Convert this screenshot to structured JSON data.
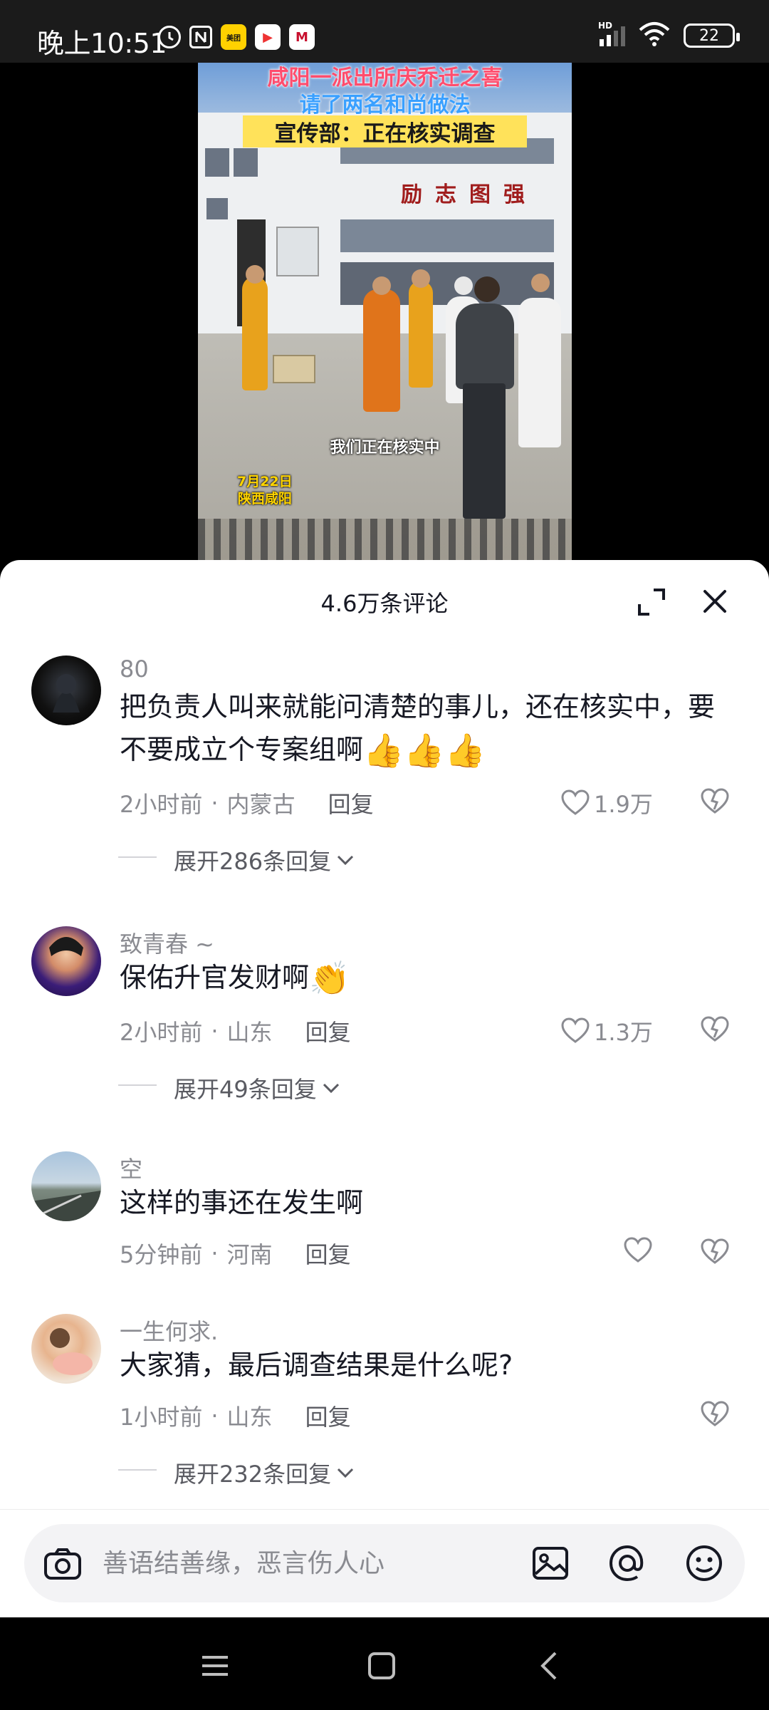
{
  "status_bar": {
    "time": "晚上10:51",
    "battery": "22",
    "icons": [
      "alarm-icon",
      "nfc-icon",
      "meituan-app-icon",
      "video-app-icon",
      "bank-app-icon",
      "hd-signal-icon",
      "wifi-icon",
      "battery-icon"
    ],
    "app_labels": {
      "meituan": "美团",
      "video": "▶",
      "bank": "M"
    },
    "hd_label": "HD"
  },
  "video": {
    "title_line1": "咸阳一派出所庆乔迁之喜",
    "title_line2": "请了两名和尚做法",
    "title_line3": "宣传部：正在核实调查",
    "building_sign": "励志图强",
    "subtitle": "我们正在核实中",
    "date_line1": "7月22日",
    "date_line2": "陕西咸阳"
  },
  "comments_header": {
    "title": "4.6万条评论"
  },
  "comments": [
    {
      "user": "80",
      "text": "把负责人叫来就能问清楚的事儿，还在核实中，要不要成立个专案组啊",
      "emoji": "👍👍👍",
      "time": "2小时前",
      "location": "内蒙古",
      "reply_label": "回复",
      "likes": "1.9万",
      "expand": "展开286条回复"
    },
    {
      "user": "致青春 ~",
      "text": "保佑升官发财啊",
      "emoji": "👏",
      "time": "2小时前",
      "location": "山东",
      "reply_label": "回复",
      "likes": "1.3万",
      "expand": "展开49条回复"
    },
    {
      "user": "空",
      "text": "这样的事还在发生啊",
      "emoji": "",
      "time": "5分钟前",
      "location": "河南",
      "reply_label": "回复",
      "likes": "",
      "expand": ""
    },
    {
      "user": "一生何求.",
      "text": "大家猜，最后调查结果是什么呢?",
      "emoji": "",
      "time": "1小时前",
      "location": "山东",
      "reply_label": "回复",
      "likes": "",
      "expand": "展开232条回复"
    }
  ],
  "input_bar": {
    "placeholder": "善语结善缘，恶言伤人心"
  },
  "colors": {
    "text_primary": "#161823",
    "text_secondary": "#8a8b91",
    "sheet_bg": "#ffffff",
    "input_bg": "#f3f3f5"
  }
}
